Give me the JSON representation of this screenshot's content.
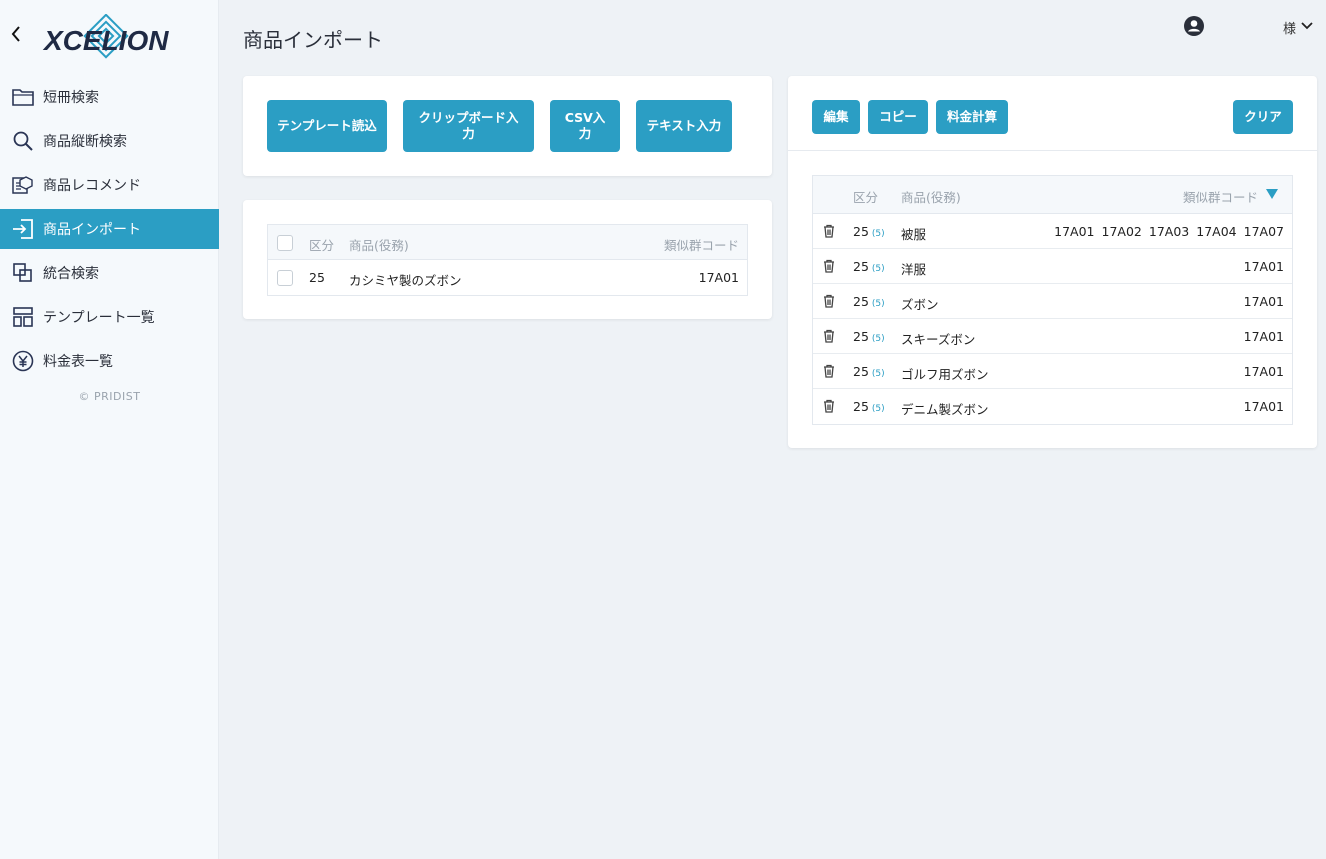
{
  "app": {
    "logo_text": "XCELION",
    "copyright": "© PRIDIST"
  },
  "sidebar": {
    "items": [
      {
        "label": "短冊検索",
        "icon": "folder-icon"
      },
      {
        "label": "商品縦断検索",
        "icon": "search-icon"
      },
      {
        "label": "商品レコメンド",
        "icon": "recommend-icon"
      },
      {
        "label": "商品インポート",
        "icon": "import-icon",
        "active": true
      },
      {
        "label": "統合検索",
        "icon": "merge-icon"
      },
      {
        "label": "テンプレート一覧",
        "icon": "template-icon"
      },
      {
        "label": "料金表一覧",
        "icon": "yen-icon"
      }
    ]
  },
  "header": {
    "title": "商品インポート",
    "user_suffix": "様"
  },
  "import_buttons": {
    "template": "テンプレート読込",
    "clipboard": "クリップボード入力",
    "csv": "CSV入力",
    "text": "テキスト入力"
  },
  "left_table": {
    "headers": {
      "class": "区分",
      "product": "商品(役務)",
      "code": "類似群コード"
    },
    "rows": [
      {
        "class": "25",
        "product": "カシミヤ製のズボン",
        "code": "17A01"
      }
    ]
  },
  "right_toolbar": {
    "edit": "編集",
    "copy": "コピー",
    "calc": "料金計算",
    "clear": "クリア"
  },
  "right_table": {
    "headers": {
      "class": "区分",
      "product": "商品(役務)",
      "code": "類似群コード"
    },
    "rows": [
      {
        "class": "25",
        "count": "(5)",
        "product": "被服",
        "codes": [
          "17A01",
          "17A02",
          "17A03",
          "17A04",
          "17A07"
        ]
      },
      {
        "class": "25",
        "count": "(5)",
        "product": "洋服",
        "codes": [
          "17A01"
        ]
      },
      {
        "class": "25",
        "count": "(5)",
        "product": "ズボン",
        "codes": [
          "17A01"
        ]
      },
      {
        "class": "25",
        "count": "(5)",
        "product": "スキーズボン",
        "codes": [
          "17A01"
        ]
      },
      {
        "class": "25",
        "count": "(5)",
        "product": "ゴルフ用ズボン",
        "codes": [
          "17A01"
        ]
      },
      {
        "class": "25",
        "count": "(5)",
        "product": "デニム製ズボン",
        "codes": [
          "17A01"
        ]
      }
    ]
  },
  "colors": {
    "accent": "#2b9ec4",
    "sidebar_bg": "#f5f9fc",
    "page_bg": "#eef2f6"
  }
}
